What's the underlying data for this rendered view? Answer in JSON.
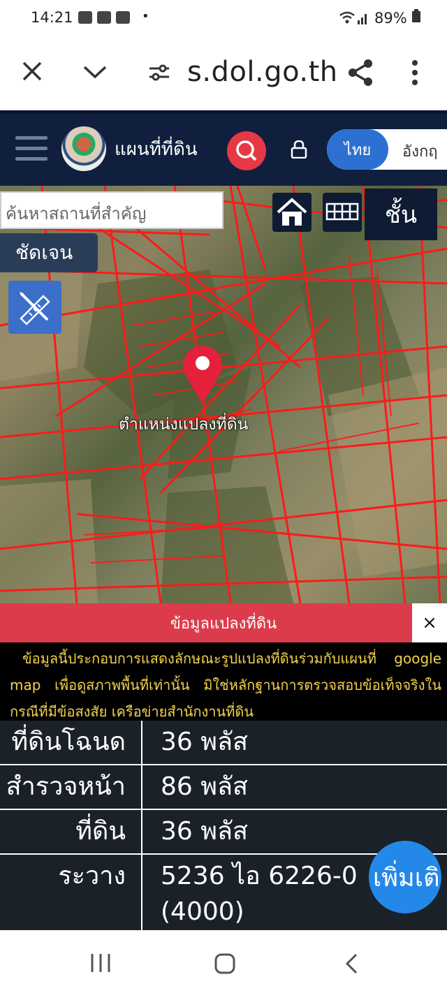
{
  "status": {
    "time": "14:21",
    "battery": "89%"
  },
  "browser": {
    "url": "s.dol.go.th"
  },
  "header": {
    "title": "แผนที่ที่ดิน",
    "lang_th": "ไทย",
    "lang_en": "อังกฤ"
  },
  "map": {
    "search_placeholder": "ค้นหาสถานที่สำคัญ",
    "layers_label": "ชั้น",
    "clear_label": "ชัดเจน",
    "pin_label": "ตำแหน่งแปลงที่ดิน"
  },
  "panel": {
    "title": "ข้อมูลแปลงที่ดิน",
    "close": "×",
    "disclaimer": "ข้อมูลนี้ประกอบการแสดงลักษณะรูปแปลงที่ดินร่วมกับแผนที่ google map เพื่อดูสภาพพื้นที่เท่านั้น มิใช่หลักฐานการตรวจสอบข้อเท็จจริงในกรณีที่มีข้อสงสัย เครือข่ายสำนักงานที่ดิน",
    "rows": [
      {
        "label": "ที่ดินโฉนด",
        "value": "36 พลัส"
      },
      {
        "label": "สำรวจหน้า",
        "value": "86 พลัส"
      },
      {
        "label": "ที่ดิน",
        "value": "36 พลัส"
      },
      {
        "label": "ระวาง",
        "value": "5236 ไอ 6226-0",
        "value_line2": "(4000)"
      }
    ],
    "more_label": "เพิ่มเติ"
  },
  "colors": {
    "header_bg": "#0f1f3d",
    "accent_red": "#dc3b4b",
    "accent_blue": "#2d70d3",
    "parcel_line": "#ff1a1a"
  }
}
